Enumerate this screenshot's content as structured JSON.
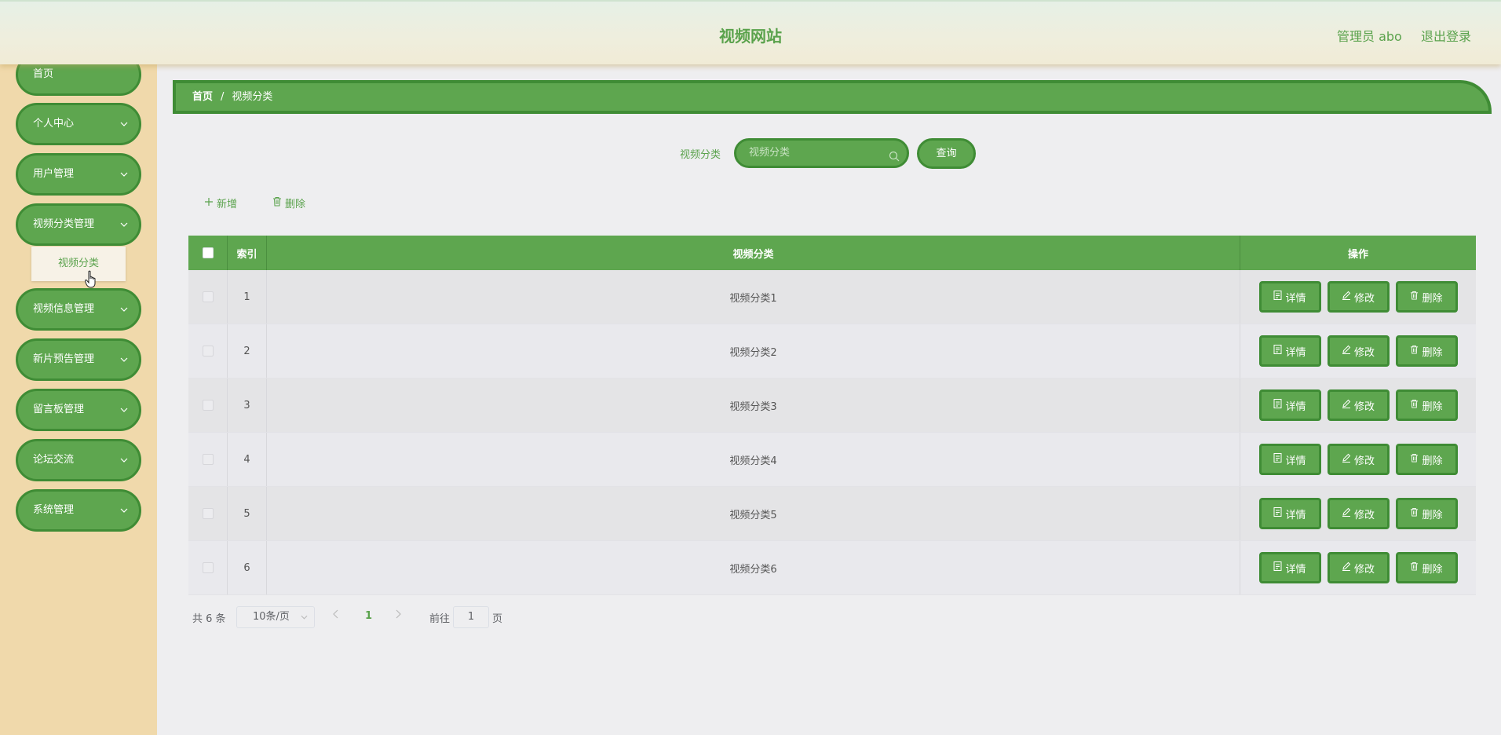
{
  "header": {
    "title": "视频网站",
    "user": "管理员 abo",
    "logout": "退出登录"
  },
  "sidebar": {
    "items": [
      {
        "label": "首页"
      },
      {
        "label": "个人中心"
      },
      {
        "label": "用户管理"
      },
      {
        "label": "视频分类管理"
      },
      {
        "label": "视频信息管理"
      },
      {
        "label": "新片预告管理"
      },
      {
        "label": "留言板管理"
      },
      {
        "label": "论坛交流"
      },
      {
        "label": "系统管理"
      }
    ],
    "submenu_item": "视频分类"
  },
  "breadcrumb": {
    "home": "首页",
    "separator": "/",
    "current": "视频分类"
  },
  "search": {
    "label": "视频分类",
    "placeholder": "视频分类",
    "button": "查询"
  },
  "actions": {
    "add": "新增",
    "delete": "删除"
  },
  "table": {
    "headers": {
      "index": "索引",
      "name": "视频分类",
      "ops": "操作"
    },
    "rows": [
      {
        "index": "1",
        "name": "视频分类1"
      },
      {
        "index": "2",
        "name": "视频分类2"
      },
      {
        "index": "3",
        "name": "视频分类3"
      },
      {
        "index": "4",
        "name": "视频分类4"
      },
      {
        "index": "5",
        "name": "视频分类5"
      },
      {
        "index": "6",
        "name": "视频分类6"
      }
    ],
    "row_actions": {
      "detail": "详情",
      "edit": "修改",
      "delete": "删除"
    }
  },
  "pagination": {
    "total": "共 6 条",
    "page_size": "10条/页",
    "current_page": "1",
    "goto_label": "前往",
    "goto_value": "1",
    "page_suffix": "页"
  },
  "colors": {
    "primary": "#5ea64f",
    "primary_border": "#3f8c35",
    "sidebar_bg": "#f0d9ab",
    "page_bg": "#eeeef0"
  }
}
